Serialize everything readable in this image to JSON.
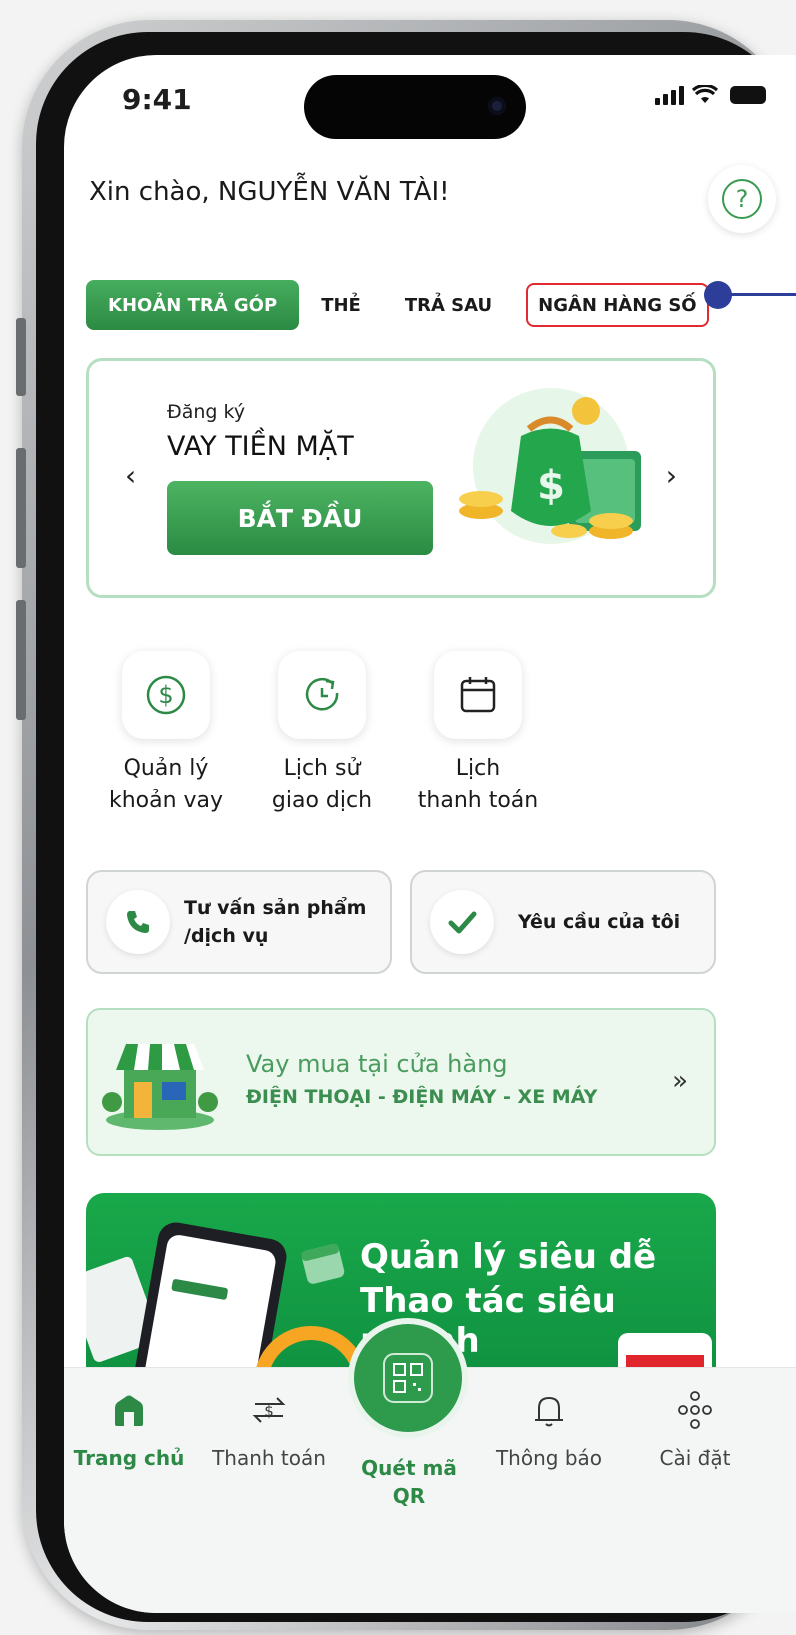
{
  "status": {
    "time": "9:41"
  },
  "header": {
    "greeting": "Xin chào, NGUYỄN VĂN TÀI!",
    "help_symbol": "?"
  },
  "tabs": [
    {
      "label": "KHOẢN TRẢ GÓP",
      "active": true
    },
    {
      "label": "THẺ"
    },
    {
      "label": "TRẢ SAU"
    },
    {
      "label": "NGÂN HÀNG SỐ",
      "highlighted": true
    }
  ],
  "promo": {
    "subtitle": "Đăng ký",
    "title": "VAY TIỀN MẶT",
    "button": "BẮT ĐẦU",
    "prev_arrow": "‹",
    "next_arrow": "›"
  },
  "quick_actions": [
    {
      "icon": "dollar-circle-icon",
      "label_line1": "Quản lý",
      "label_line2": "khoản vay"
    },
    {
      "icon": "history-clock-icon",
      "label_line1": "Lịch sử",
      "label_line2": "giao dịch"
    },
    {
      "icon": "calendar-icon",
      "label_line1": "Lịch",
      "label_line2": "thanh toán"
    }
  ],
  "cards": {
    "consult": {
      "line1": "Tư vấn sản phẩm",
      "line2": "/dịch vụ"
    },
    "requests": {
      "label": "Yêu cầu của tôi"
    }
  },
  "store_banner": {
    "line1": "Vay mua tại cửa hàng",
    "line2": "ĐIỆN THOẠI - ĐIỆN MÁY - XE MÁY",
    "arrow": "»"
  },
  "ad_banner": {
    "line1": "Quản lý siêu dễ",
    "line2": "Thao tác siêu nhanh"
  },
  "bottom_nav": [
    {
      "label": "Trang chủ",
      "active": true
    },
    {
      "label": "Thanh toán"
    },
    {
      "label": "Quét mã QR"
    },
    {
      "label": "Thông báo"
    },
    {
      "label": "Cài đặt"
    }
  ],
  "colors": {
    "primary_green": "#2d8a46",
    "highlight_red": "#e02b32",
    "annotation_blue": "#2c3e9a"
  }
}
